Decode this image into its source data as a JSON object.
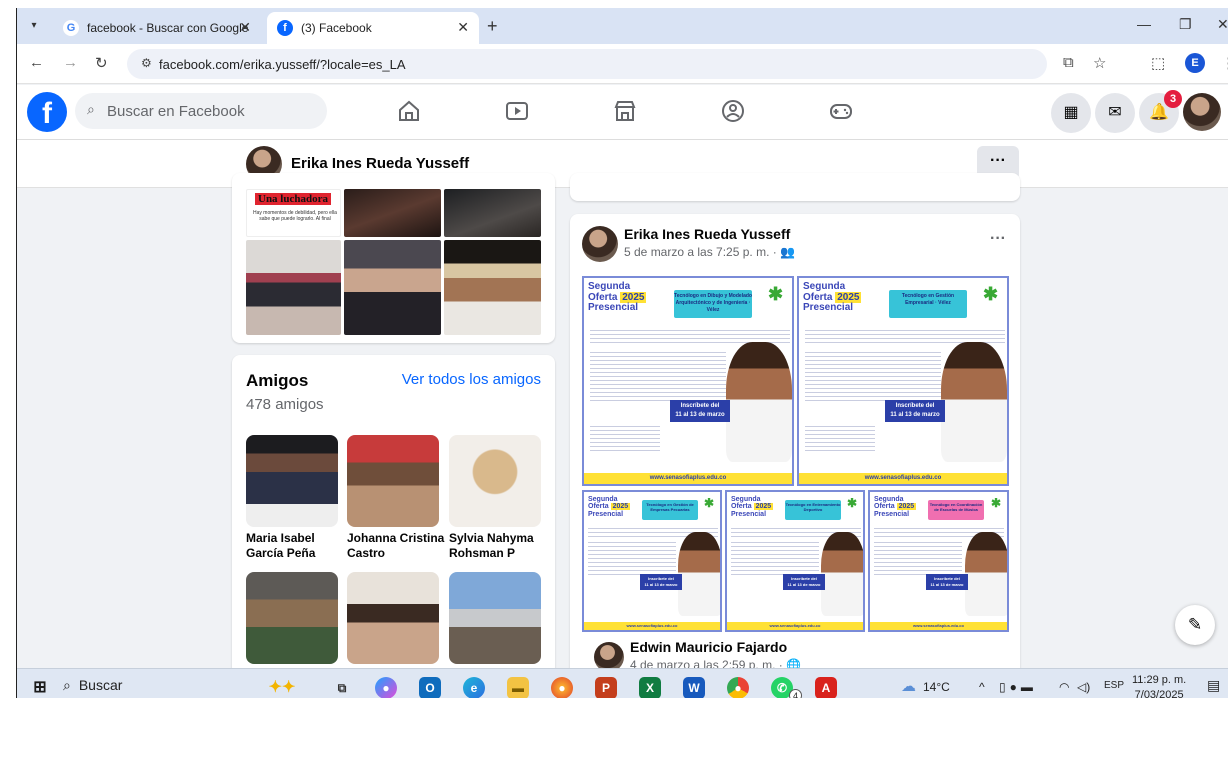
{
  "browser": {
    "tabs": [
      {
        "title": "facebook - Buscar con Google",
        "favicon": "G"
      },
      {
        "title": "(3) Facebook",
        "favicon": "f"
      }
    ],
    "url": "facebook.com/erika.yusseff/?locale=es_LA",
    "profile_initial": "E"
  },
  "facebook": {
    "search_placeholder": "Buscar en Facebook",
    "notifications_count": "3",
    "brand_color": "#0866ff"
  },
  "profile": {
    "name": "Erika Ines Rueda Yusseff",
    "more_label": "···"
  },
  "photos": {
    "quote_title": "Una luchadora",
    "quote_text": "Hay momentos de debilidad, pero ella sabe que puede lograrlo. Al final"
  },
  "friends": {
    "title": "Amigos",
    "count": "478 amigos",
    "see_all": "Ver todos los amigos",
    "list": [
      {
        "name": "Maria Isabel García Peña"
      },
      {
        "name": "Johanna Cristina Castro"
      },
      {
        "name": "Sylvia Nahyma Rohsman P"
      }
    ]
  },
  "post": {
    "author": "Erika Ines Rueda Yusseff",
    "date": "5 de marzo a las 7:25 p. m. · ",
    "flyers": [
      {
        "line1": "Segunda",
        "line2": "Oferta",
        "year": "2025",
        "line3": "Presencial",
        "program": "Tecnólogo en Dibujo y Modelado Arquitectónico y de Ingeniería · Vélez",
        "cta1": "Inscríbete del",
        "cta2": "11 al 13 de marzo",
        "web": "www.senasofiaplus.edu.co"
      },
      {
        "line1": "Segunda",
        "line2": "Oferta",
        "year": "2025",
        "line3": "Presencial",
        "program": "Tecnólogo en Gestión Empresarial · Vélez",
        "cta1": "Inscríbete del",
        "cta2": "11 al 13 de marzo",
        "web": "www.senasofiaplus.edu.co"
      },
      {
        "line1": "Segunda",
        "line2": "Oferta",
        "year": "2025",
        "line3": "Presencial",
        "program": "Tecnólogo en Gestión de Empresas Pecuarias",
        "cta1": "Inscríbete del",
        "cta2": "11 al 13 de marzo",
        "web": "www.senasofiaplus.edu.co"
      },
      {
        "line1": "Segunda",
        "line2": "Oferta",
        "year": "2025",
        "line3": "Presencial",
        "program": "Tecnólogo en Entrenamiento Deportivo",
        "cta1": "Inscríbete del",
        "cta2": "11 al 13 de marzo",
        "web": "www.senasofiaplus.edu.co"
      },
      {
        "line1": "Segunda",
        "line2": "Oferta",
        "year": "2025",
        "line3": "Presencial",
        "program": "Tecnólogo en Coordinación de Escuelas de Música",
        "cta1": "Inscríbete del",
        "cta2": "11 al 13 de marzo",
        "web": "www.senasofiaplus.edu.co"
      }
    ]
  },
  "post2": {
    "author": "Edwin Mauricio Fajardo",
    "date": "4 de marzo a las 2:59 p. m. · "
  },
  "taskbar": {
    "search": "Buscar",
    "whatsapp_badge": "4",
    "weather": "14°C",
    "lang": "ESP",
    "time": "11:29 p. m.",
    "date": "7/03/2025"
  }
}
